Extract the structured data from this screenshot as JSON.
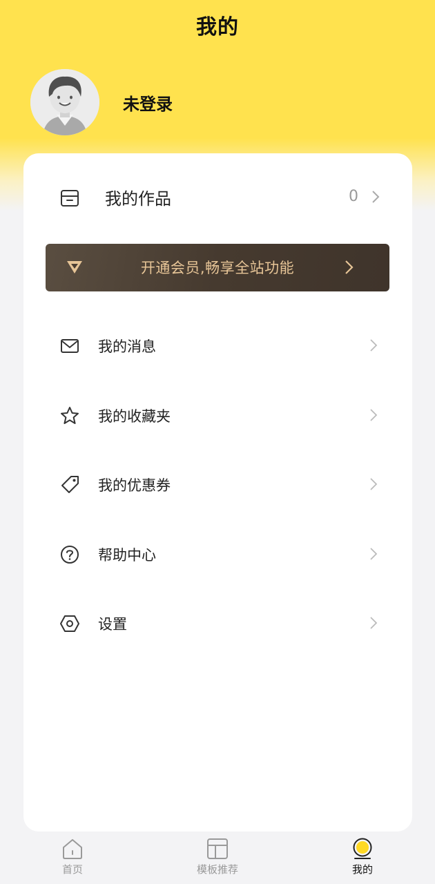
{
  "header": {
    "title": "我的"
  },
  "profile": {
    "username": "未登录",
    "avatar_icon": "default-avatar-icon"
  },
  "works": {
    "label": "我的作品",
    "count": "0",
    "icon": "archive-box-icon"
  },
  "vip_banner": {
    "text": "开通会员,畅享全站功能",
    "icon": "diamond-icon",
    "text_color": "#e7c597",
    "background": "#4a3e33"
  },
  "menu": {
    "items": [
      {
        "label": "我的消息",
        "icon": "envelope-icon"
      },
      {
        "label": "我的收藏夹",
        "icon": "star-icon"
      },
      {
        "label": "我的优惠券",
        "icon": "tag-icon"
      },
      {
        "label": "帮助中心",
        "icon": "help-circle-icon"
      },
      {
        "label": "设置",
        "icon": "hexagon-settings-icon"
      }
    ]
  },
  "tabbar": {
    "tabs": [
      {
        "label": "首页",
        "icon": "home-icon",
        "active": false
      },
      {
        "label": "模板推荐",
        "icon": "template-layout-icon",
        "active": false
      },
      {
        "label": "我的",
        "icon": "profile-dot-icon",
        "active": true
      }
    ]
  },
  "colors": {
    "brand_yellow": "#ffe24e",
    "page_background": "#f3f3f5",
    "card_background": "#ffffff",
    "muted_text": "#999999"
  }
}
